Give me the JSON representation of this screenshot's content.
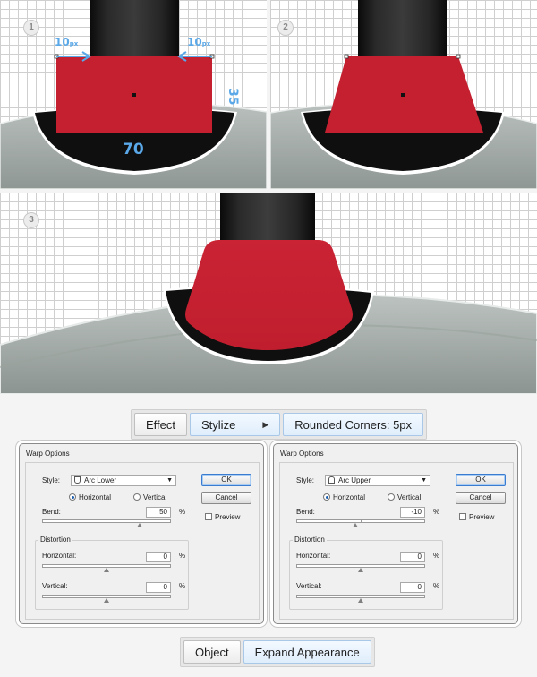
{
  "steps": [
    {
      "number": "1",
      "dims": {
        "left": "10",
        "right": "10",
        "unit": "px",
        "height": "35",
        "width": "70"
      }
    },
    {
      "number": "2"
    },
    {
      "number": "3"
    }
  ],
  "colors": {
    "red": "#c42030",
    "black": "#0d0d0d",
    "plate": "#a8afac",
    "accent": "#5aa8e8"
  },
  "menu_path_1": {
    "effect": "Effect",
    "stylize": "Stylize",
    "rounded": "Rounded Corners: 5px"
  },
  "menu_path_2": {
    "object": "Object",
    "expand": "Expand Appearance"
  },
  "dialogs": [
    {
      "title": "Warp Options",
      "style_label": "Style:",
      "style_value": "Arc Lower",
      "horizontal": "Horizontal",
      "vertical": "Vertical",
      "orientation_selected": "Horizontal",
      "bend_label": "Bend:",
      "bend_value": "50",
      "bend_position": 0.75,
      "percent": "%",
      "distortion_label": "Distortion",
      "h_label": "Horizontal:",
      "h_value": "0",
      "v_label": "Vertical:",
      "v_value": "0",
      "ok": "OK",
      "cancel": "Cancel",
      "preview": "Preview"
    },
    {
      "title": "Warp Options",
      "style_label": "Style:",
      "style_value": "Arc Upper",
      "horizontal": "Horizontal",
      "vertical": "Vertical",
      "orientation_selected": "Horizontal",
      "bend_label": "Bend:",
      "bend_value": "-10",
      "bend_position": 0.45,
      "percent": "%",
      "distortion_label": "Distortion",
      "h_label": "Horizontal:",
      "h_value": "0",
      "v_label": "Vertical:",
      "v_value": "0",
      "ok": "OK",
      "cancel": "Cancel",
      "preview": "Preview"
    }
  ]
}
